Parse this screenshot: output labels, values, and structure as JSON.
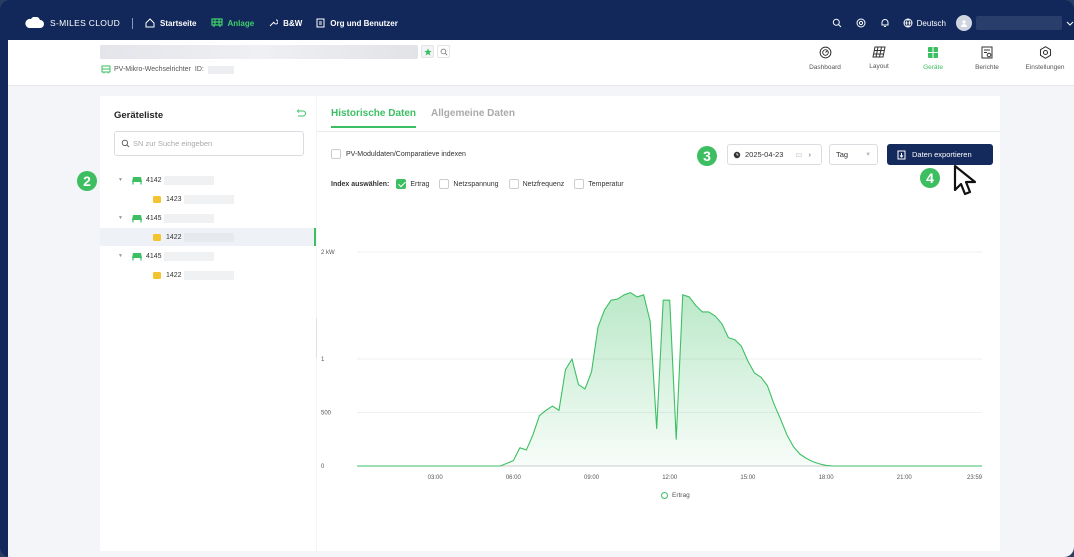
{
  "brand": "S-MILES CLOUD",
  "nav": [
    {
      "label": "Startseite"
    },
    {
      "label": "Anlage"
    },
    {
      "label": "B&W"
    },
    {
      "label": "Org und Benutzer"
    }
  ],
  "language": "Deutsch",
  "device": {
    "type_label": "PV-Mikro-Wechselrichter",
    "id_label": "ID:"
  },
  "right_tabs": [
    {
      "label": "Dashboard"
    },
    {
      "label": "Layout"
    },
    {
      "label": "Geräte"
    },
    {
      "label": "Berichte"
    },
    {
      "label": "Einstellungen"
    }
  ],
  "device_list": {
    "title": "Geräteliste",
    "search_placeholder": "SN zur Suche eingeben",
    "tree": [
      {
        "label": "4142",
        "children": [
          "1423"
        ]
      },
      {
        "label": "4145",
        "children": [
          "1422"
        ]
      },
      {
        "label": "4145",
        "children": [
          "1422"
        ]
      }
    ]
  },
  "main": {
    "tabs": [
      "Historische Daten",
      "Allgemeine Daten"
    ],
    "pv_checkbox_label": "PV-Moduldaten/Comparatieve indexen",
    "date": "2025-04-23",
    "period": "Tag",
    "export_label": "Daten exportieren",
    "index_label": "Index auswählen:",
    "indices": [
      {
        "label": "Ertrag",
        "checked": true
      },
      {
        "label": "Netzspannung",
        "checked": false
      },
      {
        "label": "Netzfrequenz",
        "checked": false
      },
      {
        "label": "Temperatur",
        "checked": false
      }
    ]
  },
  "annotations": {
    "b2": "2",
    "b3": "3",
    "b4": "4"
  },
  "colors": {
    "accent": "#3cbf63",
    "nav_bg": "#12285a",
    "export_btn": "#14295c"
  },
  "chart_data": {
    "type": "area",
    "series": [
      {
        "name": "Ertrag"
      }
    ],
    "y_tick_labels": [
      "2 kW",
      "1",
      "500",
      "0"
    ],
    "x_tick_labels": [
      "03:00",
      "06:00",
      "09:00",
      "12:00",
      "15:00",
      "18:00",
      "21:00",
      "23:59"
    ],
    "x": [
      "05:00",
      "05:30",
      "06:00",
      "06:15",
      "06:30",
      "06:45",
      "07:00",
      "07:15",
      "07:30",
      "07:45",
      "08:00",
      "08:15",
      "08:30",
      "08:45",
      "09:00",
      "09:15",
      "09:30",
      "09:45",
      "10:00",
      "10:15",
      "10:30",
      "10:45",
      "11:00",
      "11:15",
      "11:30",
      "11:45",
      "12:00",
      "12:15",
      "12:30",
      "12:45",
      "13:00",
      "13:15",
      "13:30",
      "13:45",
      "14:00",
      "14:15",
      "14:30",
      "14:45",
      "15:00",
      "15:15",
      "15:30",
      "15:45",
      "16:00",
      "16:15",
      "16:30",
      "16:45",
      "17:00",
      "17:15",
      "17:30",
      "17:45",
      "18:00",
      "18:15"
    ],
    "values": [
      0,
      0,
      50,
      170,
      150,
      290,
      470,
      520,
      560,
      520,
      900,
      1000,
      760,
      720,
      880,
      1300,
      1460,
      1550,
      1560,
      1600,
      1620,
      1580,
      1600,
      1350,
      350,
      1550,
      1550,
      250,
      1600,
      1580,
      1500,
      1440,
      1440,
      1400,
      1330,
      1200,
      1180,
      1120,
      980,
      870,
      830,
      750,
      580,
      440,
      290,
      180,
      110,
      70,
      40,
      20,
      5,
      0
    ]
  }
}
